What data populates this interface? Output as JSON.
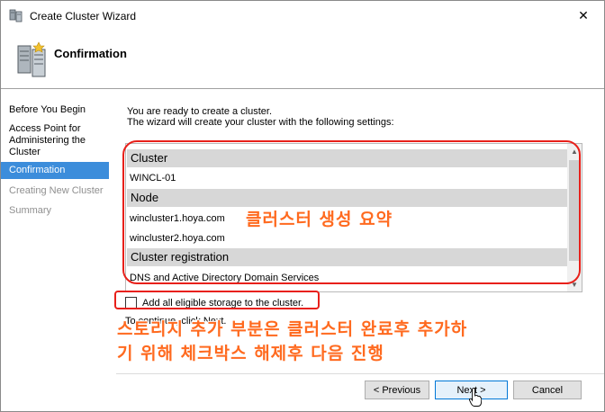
{
  "window": {
    "title": "Create Cluster Wizard",
    "close_glyph": "✕"
  },
  "header": {
    "title": "Confirmation",
    "icon": "cluster-servers-icon"
  },
  "nav": {
    "items": [
      {
        "label": "Before You Begin",
        "state": "normal"
      },
      {
        "label": "Access Point for Administering the Cluster",
        "state": "normal"
      },
      {
        "label": "Confirmation",
        "state": "active"
      },
      {
        "label": "Creating New Cluster",
        "state": "disabled"
      },
      {
        "label": "Summary",
        "state": "disabled"
      }
    ]
  },
  "main": {
    "intro_line1": "You are ready to create a cluster.",
    "intro_line2": "The wizard will create your cluster with the following settings:",
    "settings": {
      "cluster_header": "Cluster",
      "cluster_name": "WINCL-01",
      "node_header": "Node",
      "node1": "wincluster1.hoya.com",
      "node2": "wincluster2.hoya.com",
      "registration_header": "Cluster registration",
      "registration_value": "DNS and Active Directory Domain Services"
    },
    "add_storage_label": "Add all eligible storage to the cluster.",
    "add_storage_checked": false,
    "continue_text": "To continue, click Next."
  },
  "annotations": {
    "summary_note": "클러스터 생성 요약",
    "checkbox_note_line1": "스토리지 추가 부분은 클러스터 완료후 추가하",
    "checkbox_note_line2": "기 위해 체크박스 해제후 다음 진행",
    "color": "#ff6a1f",
    "box_color": "#e8201a"
  },
  "footer": {
    "previous_label": "< Previous",
    "next_label": "Next >",
    "cancel_label": "Cancel"
  },
  "colors": {
    "nav_active": "#3c8ddb",
    "section_header": "#d7d7d7",
    "next_border": "#0078d7"
  }
}
